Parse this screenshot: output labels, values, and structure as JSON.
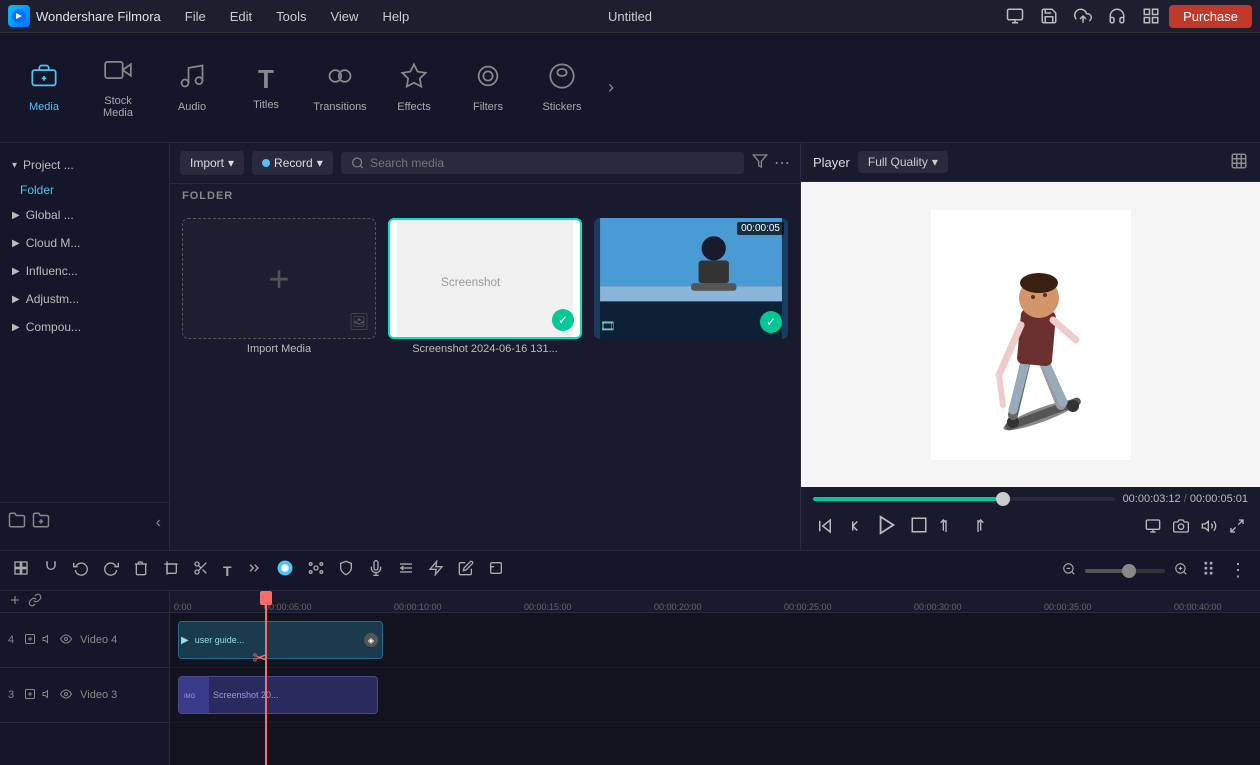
{
  "app": {
    "name": "Wondershare Filmora",
    "title": "Untitled"
  },
  "menu": {
    "items": [
      "File",
      "Edit",
      "Tools",
      "View",
      "Help"
    ]
  },
  "purchase_btn": "Purchase",
  "toolbar": {
    "items": [
      {
        "id": "media",
        "label": "Media",
        "icon": "🎞",
        "active": true
      },
      {
        "id": "stock-media",
        "label": "Stock Media",
        "icon": "🎬"
      },
      {
        "id": "audio",
        "label": "Audio",
        "icon": "🎵"
      },
      {
        "id": "titles",
        "label": "Titles",
        "icon": "T"
      },
      {
        "id": "transitions",
        "label": "Transitions",
        "icon": "⇄"
      },
      {
        "id": "effects",
        "label": "Effects",
        "icon": "✦"
      },
      {
        "id": "filters",
        "label": "Filters",
        "icon": "🔘"
      },
      {
        "id": "stickers",
        "label": "Stickers",
        "icon": "⭐"
      }
    ],
    "more": "›"
  },
  "left_panel": {
    "items": [
      {
        "label": "Project ...",
        "arrow": "▾",
        "active": false
      },
      {
        "label": "Folder",
        "active": true
      },
      {
        "label": "Global ...",
        "arrow": "▶"
      },
      {
        "label": "Cloud M...",
        "arrow": "▶"
      },
      {
        "label": "Influenc...",
        "arrow": "▶"
      },
      {
        "label": "Adjustm...",
        "arrow": "▶"
      },
      {
        "label": "Compou...",
        "arrow": "▶"
      }
    ]
  },
  "media_panel": {
    "import_btn": "Import",
    "record_btn": "Record",
    "search_placeholder": "Search media",
    "folder_label": "FOLDER",
    "items": [
      {
        "id": "import",
        "label": "Import Media",
        "type": "import"
      },
      {
        "id": "screenshot",
        "label": "Screenshot 2024-06-16 131...",
        "type": "screenshot",
        "selected": true
      },
      {
        "id": "video",
        "label": "",
        "type": "video",
        "duration": "00:00:05",
        "checked": true
      }
    ]
  },
  "player": {
    "label": "Player",
    "quality": "Full Quality",
    "current_time": "00:00:03:12",
    "total_time": "00:00:05:01",
    "progress_percent": 63
  },
  "timeline": {
    "tracks": [
      {
        "num": "4",
        "label": "Video 4",
        "clip_label": "user guide..."
      },
      {
        "num": "3",
        "label": "Video 3",
        "clip_label": "Screenshot 20..."
      }
    ],
    "ruler_marks": [
      "0:00",
      "00:00:05:00",
      "00:00:10:00",
      "00:00:15:00",
      "00:00:20:00",
      "00:00:25:00",
      "00:00:30:00",
      "00:00:35:00",
      "00:00:40:00"
    ]
  }
}
